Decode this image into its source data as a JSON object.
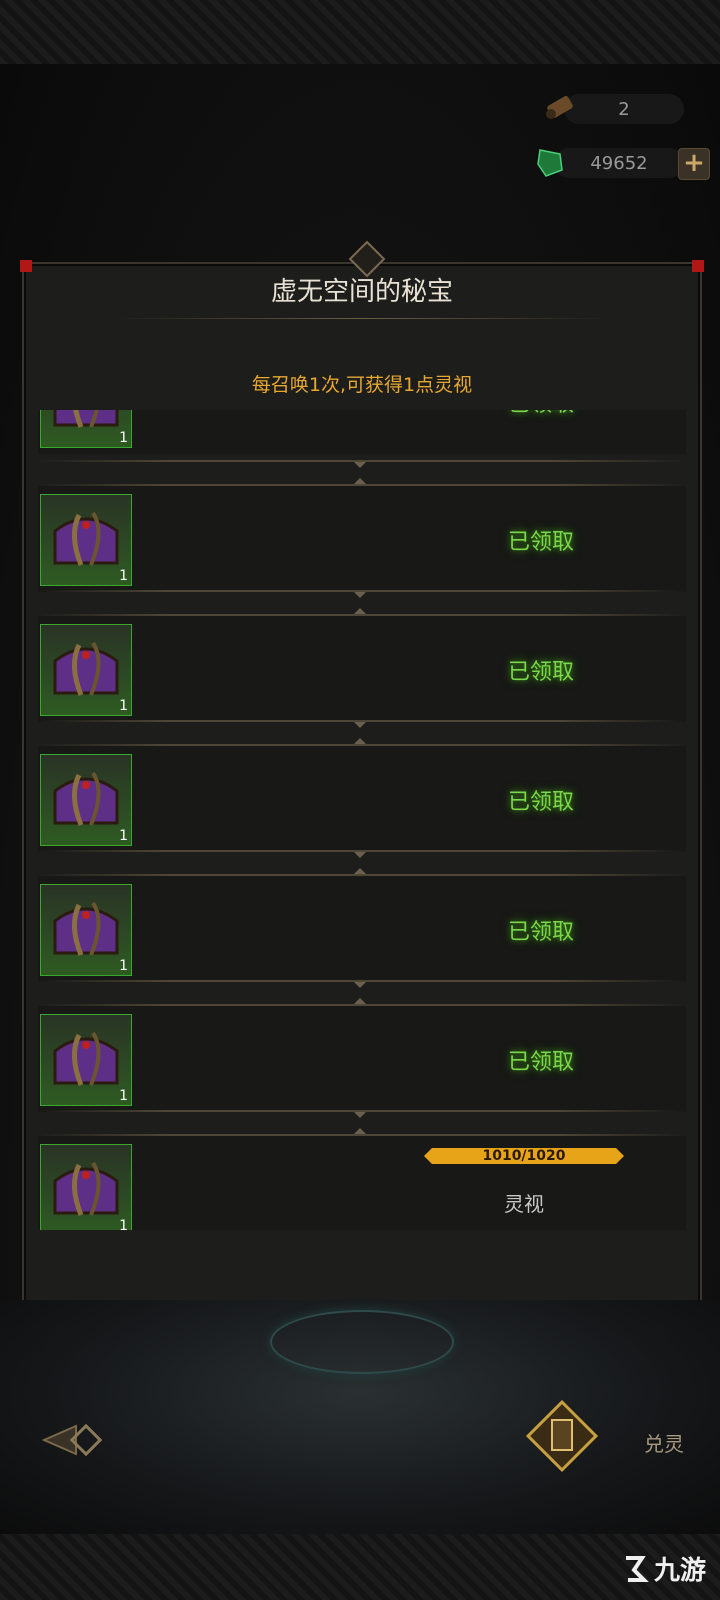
{
  "resources": {
    "scroll_count": "2",
    "gem_count": "49652",
    "add_label": "+"
  },
  "modal": {
    "title": "虚无空间的秘宝",
    "subtitle": "每召唤1次,可获得1点灵视",
    "rows": [
      {
        "quantity": "1",
        "status": "已领取",
        "partial": true
      },
      {
        "quantity": "1",
        "status": "已领取"
      },
      {
        "quantity": "1",
        "status": "已领取"
      },
      {
        "quantity": "1",
        "status": "已领取"
      },
      {
        "quantity": "1",
        "status": "已领取"
      },
      {
        "quantity": "1",
        "status": "已领取"
      },
      {
        "quantity": "1",
        "progress_text": "1010/1020",
        "progress": 0.99,
        "requirement": "灵视"
      }
    ]
  },
  "footer": {
    "exchange_label": "兑灵",
    "watermark": "九游"
  },
  "colors": {
    "claimed": "#7ad84a",
    "progress_fill": "#e8a418",
    "subtitle": "#e6a830"
  },
  "icons": [
    "scroll-icon",
    "green-gem-icon",
    "treasure-chest-icon",
    "back-arrow-icon",
    "exchange-card-icon"
  ]
}
